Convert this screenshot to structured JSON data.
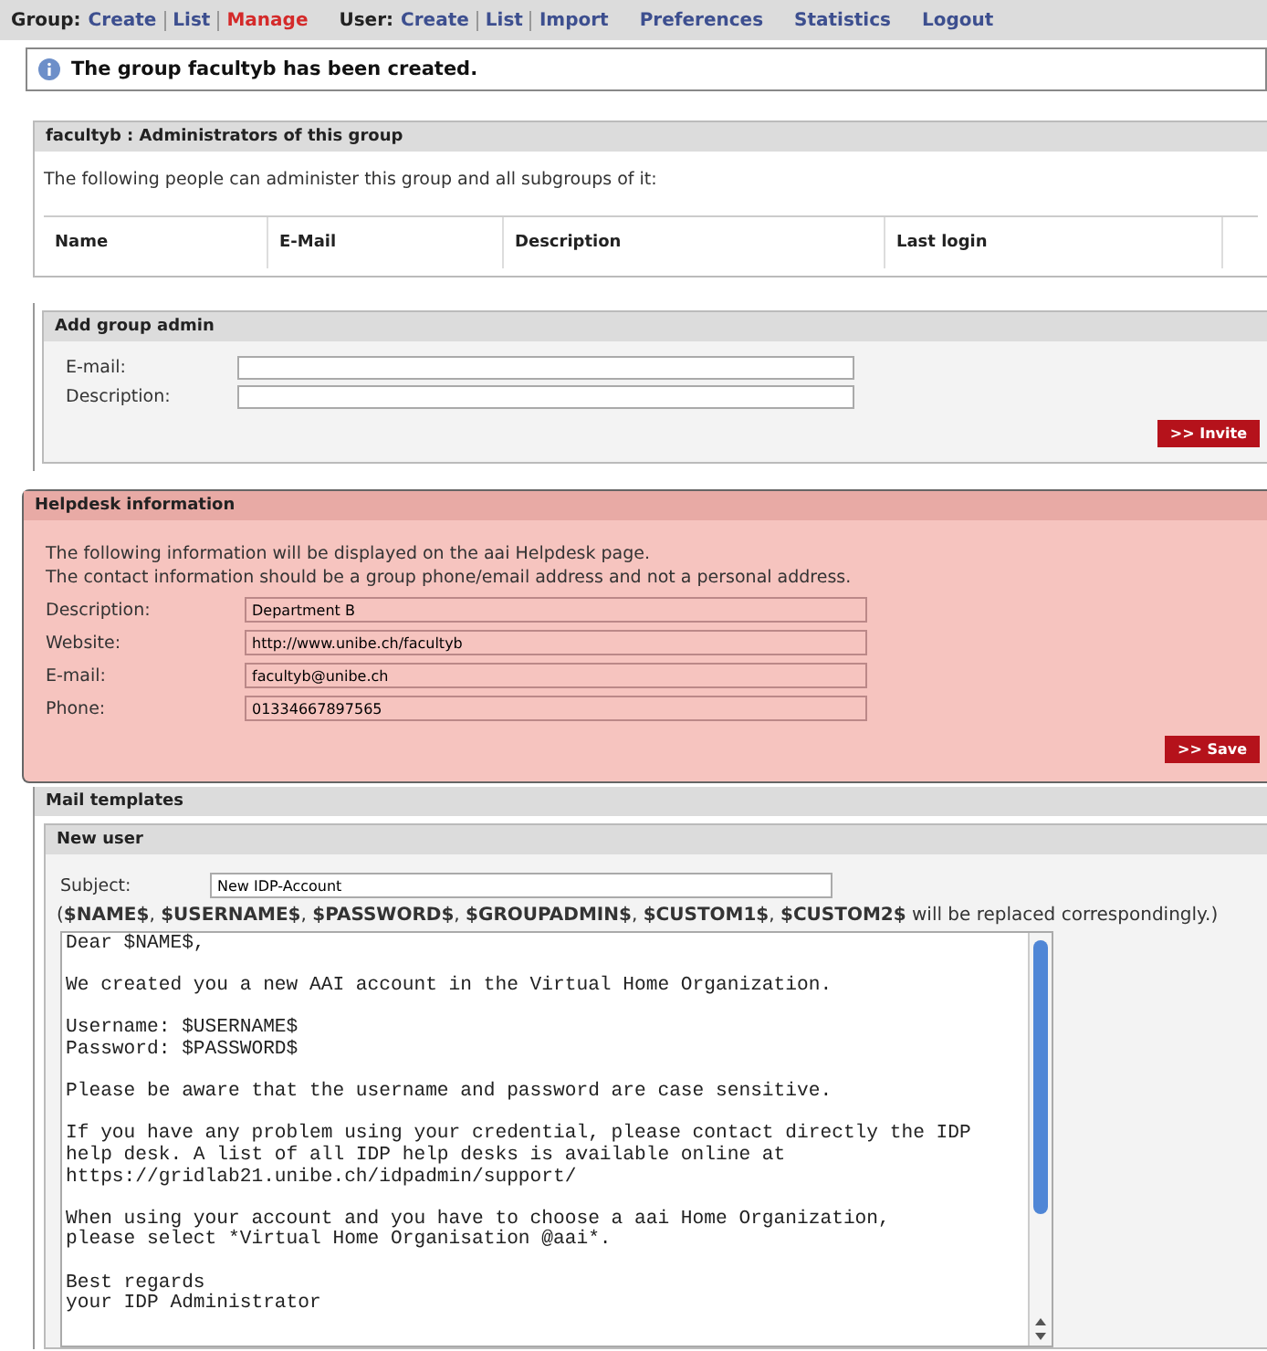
{
  "nav": [
    {
      "label": "Group:",
      "links": [
        {
          "label": "Create",
          "selected": false
        },
        {
          "label": "List",
          "selected": false
        },
        {
          "label": "Manage",
          "selected": true
        }
      ]
    },
    {
      "label": "User:",
      "links": [
        {
          "label": "Create",
          "selected": false
        },
        {
          "label": "List",
          "selected": false
        },
        {
          "label": "Import",
          "selected": false
        }
      ]
    },
    {
      "links": [
        {
          "label": "Preferences",
          "selected": false
        }
      ]
    },
    {
      "links": [
        {
          "label": "Statistics",
          "selected": false
        }
      ]
    },
    {
      "links": [
        {
          "label": "Logout",
          "selected": false
        }
      ]
    }
  ],
  "notice": "The group facultyb has been created.",
  "admins": {
    "title": "facultyb : Administrators of this group",
    "intro": "The following people can administer this group and all subgroups of it:",
    "columns": [
      "Name",
      "E-Mail",
      "Description",
      "Last login"
    ]
  },
  "add_admin": {
    "title": "Add group admin",
    "fields": [
      {
        "label": "E-mail:"
      },
      {
        "label": "Description:"
      }
    ],
    "button": ">> Invite"
  },
  "helpdesk": {
    "title": "Helpdesk information",
    "intro": [
      "The following information will be displayed on the aai Helpdesk page.",
      "The contact information should be a group phone/email address and not a personal address."
    ],
    "fields": [
      {
        "label": "Description:",
        "value": "Department B"
      },
      {
        "label": "Website:",
        "value": "http://www.unibe.ch/facultyb"
      },
      {
        "label": "E-mail:",
        "value": "facultyb@unibe.ch"
      },
      {
        "label": "Phone:",
        "value": "01334667897565"
      }
    ],
    "button": ">> Save"
  },
  "mail": {
    "title": "Mail templates",
    "template": {
      "title": "New user",
      "subject_label": "Subject:",
      "subject": "New IDP-Account",
      "hint": "(**$NAME$**, **$USERNAME$**, **$PASSWORD$**, **$GROUPADMIN$**, **$CUSTOM1$**, **$CUSTOM2$** will be replaced correspondingly.)",
      "body": "Dear $NAME$,\n\nWe created you a new AAI account in the Virtual Home Organization.\n\nUsername: $USERNAME$\nPassword: $PASSWORD$\n\nPlease be aware that the username and password are case sensitive.\n\nIf you have any problem using your credential, please contact directly the IDP\nhelp desk. A list of all IDP help desks is available online at\nhttps://gridlab21.unibe.ch/idpadmin/support/\n\nWhen using your account and you have to choose a aai Home Organization,\nplease select *Virtual Home Organisation @aai*.\n\nBest regards\nyour IDP Administrator"
    }
  }
}
